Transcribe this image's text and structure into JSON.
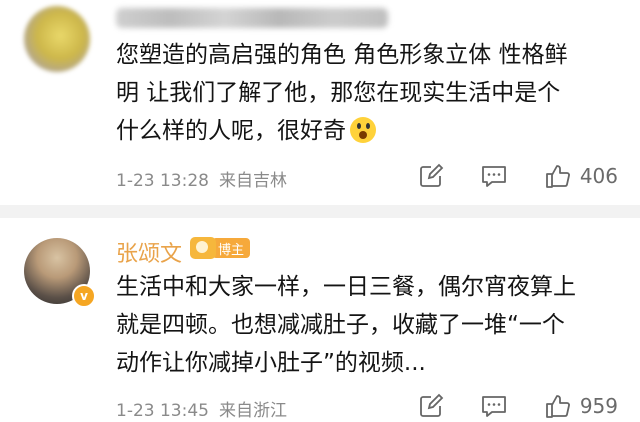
{
  "comments": [
    {
      "text_lines": [
        "您塑造的高启强的角色 角色形象立体 性格鲜",
        "明 让我们了解了他，那您在现实生活中是个",
        "什么样的人呢，很好奇"
      ],
      "emoji": "surprised-face",
      "date": "1-23 13:28",
      "location": "来自吉林",
      "likes": "406"
    },
    {
      "username": "张颂文",
      "badge": "博主",
      "verified_mark": "v",
      "text_lines": [
        "生活中和大家一样，一日三餐，偶尔宵夜算上",
        "就是四顿。也想减减肚子，收藏了一堆“一个",
        "动作让你减掉小肚子”的视频..."
      ],
      "date": "1-23 13:45",
      "location": "来自浙江",
      "likes": "959"
    }
  ],
  "colors": {
    "username": "#e9a34a",
    "badge": "#f6a93b",
    "meta": "#8a8a8a",
    "separator": "#f2f2f2"
  }
}
